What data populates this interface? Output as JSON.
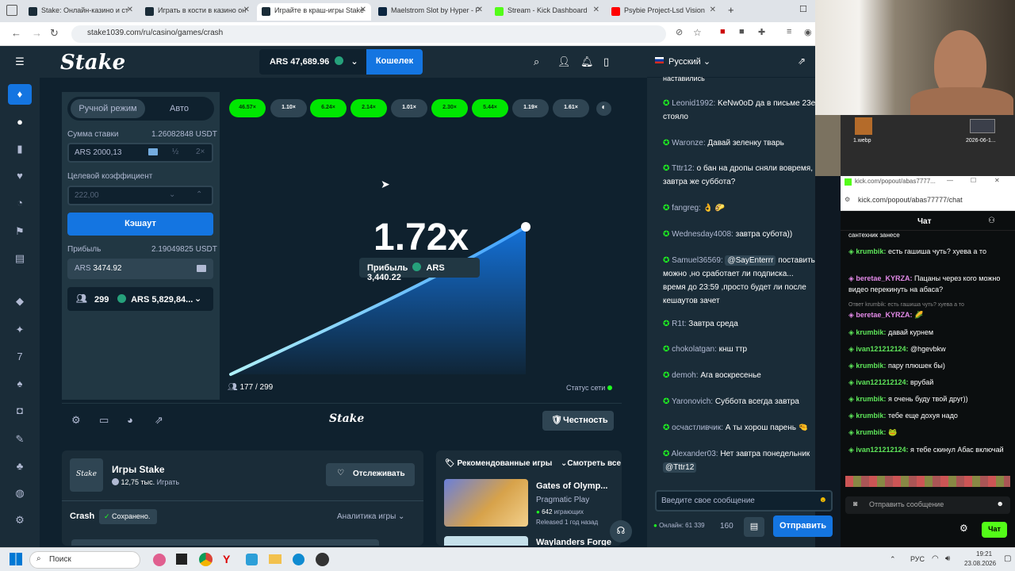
{
  "browser": {
    "tabs": [
      {
        "title": "Stake: Онлайн-казино и ст",
        "color": "#1a2c38"
      },
      {
        "title": "Играть в кости в казино он",
        "color": "#1a2c38"
      },
      {
        "title": "Играйте в краш-игры Stake",
        "color": "#1a2c38"
      },
      {
        "title": "Maelstrom Slot by Hyper - F",
        "color": "#0b2640"
      },
      {
        "title": "Stream - Kick Dashboard",
        "color": "#53fc18"
      },
      {
        "title": "Psybie Project-Lsd Vision",
        "color": "#ff0000"
      }
    ],
    "url": "stake1039.com/ru/casino/games/crash"
  },
  "topnav": {
    "logo": "Stake",
    "balance": "ARS 47,689.96",
    "wallet": "Кошелек",
    "language": "Русский"
  },
  "panel": {
    "mode_manual": "Ручной режим",
    "mode_auto": "Авто",
    "bet_label": "Сумма ставки",
    "bet_usdt": "1.26082848 USDT",
    "bet_value": "ARS 2000,13",
    "half": "½",
    "double": "2×",
    "target_label": "Целевой коэффициент",
    "target_value": "222,00",
    "cashout": "Кэшаут",
    "profit_label": "Прибыль",
    "profit_usdt": "2.19049825 USDT",
    "profit_value": "3474.92",
    "profit_currency": "ARS",
    "players_count": "299",
    "players_total": "ARS 5,829,84..."
  },
  "history": [
    "46.57×",
    "1.10×",
    "6.24×",
    "2.14×",
    "1.01×",
    "2.30×",
    "5.44×",
    "1.19×",
    "1.61×"
  ],
  "history_colors": [
    "g",
    "d",
    "g",
    "g",
    "d",
    "g",
    "g",
    "d",
    "d"
  ],
  "game": {
    "multiplier": "1.72x",
    "profit_label": "Прибыль",
    "profit_value": "ARS 3,440.22",
    "players": "177 / 299",
    "network_status": "Статус сети",
    "fairness": "Честность",
    "footer_logo": "Stake"
  },
  "info": {
    "title": "Игры Stake",
    "subtitle": "12,75 тыс.",
    "subtitle_suffix": "Играть",
    "follow": "Отслеживать",
    "game_name": "Crash",
    "saved": "Сохранено.",
    "analytics": "Аналитика игры",
    "logo": "Stake"
  },
  "recommended": {
    "title": "Рекомендованные игры",
    "see_all": "Смотреть все",
    "game1_title": "Gates of Olymp...",
    "game1_provider": "Pragmatic Play",
    "game1_players": "642",
    "game1_players_suffix": "играющих",
    "game1_released": "Released 1 год назад",
    "game2_title": "Waylanders Forge"
  },
  "chat": {
    "top_cut": "наставились",
    "messages": [
      {
        "user": "Leonid1992:",
        "text": "KeNw0oD да в письме 23е стояло"
      },
      {
        "user": "Waronze:",
        "text": "Давай зеленку тварь"
      },
      {
        "user": "Tttr12:",
        "text": "о бан на дропы сняли вовремя, завтра же суббота?"
      },
      {
        "user": "fangreg:",
        "text": "👌 🌮"
      },
      {
        "user": "Wednesday4008:",
        "text": "завтра субота))"
      },
      {
        "user": "Samuel36569:",
        "mention": "@SayEnterrr",
        "text": "поставить можно ,но сработает ли подписка... время до 23:59 ,просто будет ли после кешаутов зачет"
      },
      {
        "user": "R1t:",
        "text": "Завтра среда"
      },
      {
        "user": "chokolatgan:",
        "text": "кнш ттр"
      },
      {
        "user": "demoh:",
        "text": "Ага воскресенье"
      },
      {
        "user": "Yaronovich:",
        "text": "Суббота всегда завтра"
      },
      {
        "user": "осчастливчик:",
        "text": "А ты хорош парень 🤏"
      },
      {
        "user": "Alexander03:",
        "text": "Нет завтра понедельник",
        "mention": "@Tttr12"
      }
    ],
    "input_placeholder": "Введите свое сообщение",
    "online": "Онлайн: 61 339",
    "count": "160",
    "send": "Отправить"
  },
  "webcam": {
    "icon1_label": "1.webp",
    "icon2_label": "2026-06-1..."
  },
  "kick": {
    "url_short": "kick.com/popout/abas7777...",
    "url": "kick.com/popout/abas77777/chat",
    "header": "Чат",
    "top_cut": "сантехник занесе",
    "messages": [
      {
        "user": "krumbik:",
        "text": "есть гашиша чуть? хуева а то",
        "kind": "n"
      },
      {
        "user": "beretae_KYRZA:",
        "text": "Пацаны через кого можно видео перекинуть на абаса?",
        "kind": "p"
      },
      {
        "user": "Ответ krumbik: есть гашиша чуть? хуева а то",
        "text": "",
        "kind": "r"
      },
      {
        "user": "beretae_KYRZA:",
        "text": "🌽",
        "kind": "p"
      },
      {
        "user": "krumbik:",
        "text": "давай курнем",
        "kind": "n"
      },
      {
        "user": "ivan121212124:",
        "text": "@hgevbkw",
        "kind": "n"
      },
      {
        "user": "krumbik:",
        "text": "пару плюшек бы)",
        "kind": "n"
      },
      {
        "user": "ivan121212124:",
        "text": "врубай",
        "kind": "n"
      },
      {
        "user": "krumbik:",
        "text": "я очень буду твой друг))",
        "kind": "n"
      },
      {
        "user": "krumbik:",
        "text": "тебе еще дохуя надо",
        "kind": "n"
      },
      {
        "user": "krumbik:",
        "text": "🐸",
        "kind": "n"
      },
      {
        "user": "ivan121212124:",
        "text": "я тебе скинул Абас включай",
        "kind": "n"
      }
    ],
    "send_placeholder": "Отправить сообщение",
    "chat_button": "Чат"
  },
  "taskbar": {
    "search": "Поиск",
    "lang": "РУС",
    "time": "19:21",
    "date": "23.08.2026"
  },
  "chart_colors": {
    "line": "#3fa0ff",
    "fill": "#1475e1"
  }
}
